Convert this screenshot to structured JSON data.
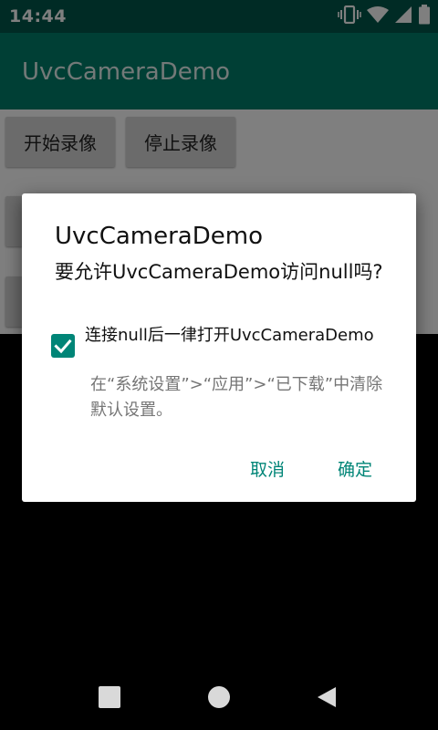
{
  "status_bar": {
    "time": "14:44",
    "icons": [
      "vibrate-icon",
      "wifi-icon",
      "signal-icon",
      "battery-icon"
    ]
  },
  "app_bar": {
    "title": "UvcCameraDemo"
  },
  "main": {
    "buttons": [
      {
        "label": "开始录像"
      },
      {
        "label": "停止录像"
      }
    ]
  },
  "dialog": {
    "title": "UvcCameraDemo",
    "message": "要允许UvcCameraDemo访问null吗?",
    "checkbox": {
      "label": "连接null后一律打开UvcCameraDemo",
      "checked": true
    },
    "hint": "在“系统设置”>“应用”>“已下载”中清除默认设置。",
    "cancel_label": "取消",
    "confirm_label": "确定"
  },
  "nav_bar": {
    "buttons": [
      "recents-icon",
      "home-icon",
      "back-icon"
    ]
  },
  "colors": {
    "status_bar": "#00574b",
    "app_bar": "#007e6a",
    "accent": "#008577"
  }
}
